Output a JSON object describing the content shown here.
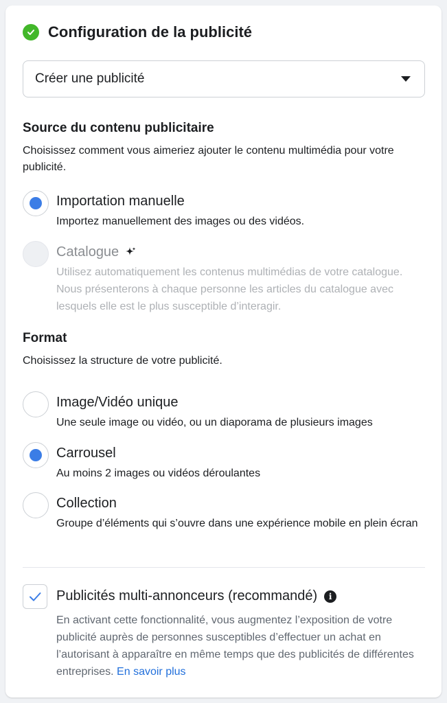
{
  "header": {
    "title": "Configuration de la publicité",
    "status_icon": "check-circle-icon",
    "status_color": "#42b72a"
  },
  "dropdown": {
    "value": "Créer une publicité",
    "icon": "caret-down-icon"
  },
  "source": {
    "title": "Source du contenu publicitaire",
    "description": "Choisissez comment vous aimeriez ajouter le contenu multimédia pour votre publicité.",
    "options": [
      {
        "label": "Importation manuelle",
        "description": "Importez manuellement des images ou des vidéos.",
        "selected": true,
        "disabled": false
      },
      {
        "label": "Catalogue",
        "description": "Utilisez automatiquement les contenus multimédias de votre catalogue. Nous présenterons à chaque personne les articles du catalogue avec lesquels elle est le plus susceptible d’interagir.",
        "selected": false,
        "disabled": true,
        "icon": "sparkle-icon"
      }
    ]
  },
  "format": {
    "title": "Format",
    "description": "Choisissez la structure de votre publicité.",
    "options": [
      {
        "label": "Image/Vidéo unique",
        "description": "Une seule image ou vidéo, ou un diaporama de plusieurs images",
        "selected": false
      },
      {
        "label": "Carrousel",
        "description": "Au moins 2 images ou vidéos déroulantes",
        "selected": true
      },
      {
        "label": "Collection",
        "description": "Groupe d’éléments qui s’ouvre dans une expérience mobile en plein écran",
        "selected": false
      }
    ]
  },
  "multi_advertiser": {
    "checked": true,
    "label": "Publicités multi-annonceurs (recommandé)",
    "info_icon": "info-icon",
    "description": "En activant cette fonctionnalité, vous augmentez l’exposition de votre publicité auprès de personnes susceptibles d’effectuer un achat en l’autorisant à apparaître en même temps que des publicités de différentes entreprises.",
    "link_text": "En savoir plus"
  },
  "colors": {
    "accent": "#3b7de6",
    "link": "#216fdb",
    "text": "#1c1e21",
    "muted": "#606770"
  }
}
